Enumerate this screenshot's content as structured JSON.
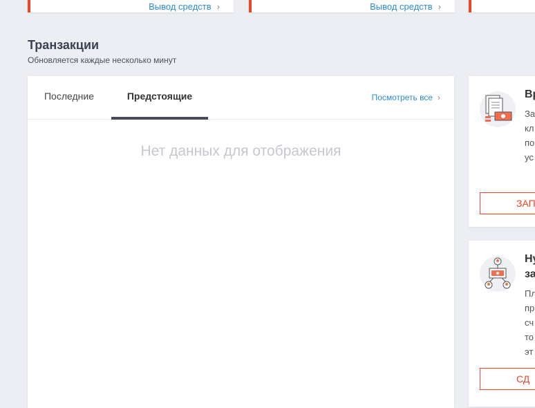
{
  "top_cards": [
    {
      "link_label": "Вывод средств"
    },
    {
      "link_label": "Вывод средств"
    }
  ],
  "transactions": {
    "title": "Транзакции",
    "subtitle": "Обновляется каждые несколько минут",
    "tabs": [
      {
        "label": "Последние",
        "active": false
      },
      {
        "label": "Предстоящие",
        "active": true
      }
    ],
    "view_all": "Посмотреть все",
    "empty_message": "Нет данных для отображения"
  },
  "side_cards": [
    {
      "title": "Вр",
      "lines": [
        "За",
        "кл",
        "по",
        "ус"
      ],
      "button_label": "ЗАП",
      "icon": "documents-money-icon"
    },
    {
      "title_lines": [
        "Ну",
        "за"
      ],
      "lines": [
        "Пл",
        "пр",
        "сч",
        "то",
        "эт"
      ],
      "button_label": "СД",
      "icon": "network-transfer-icon"
    }
  ],
  "colors": {
    "accent": "#e8472a",
    "link": "#2a8bd1",
    "background": "#eceef3"
  }
}
